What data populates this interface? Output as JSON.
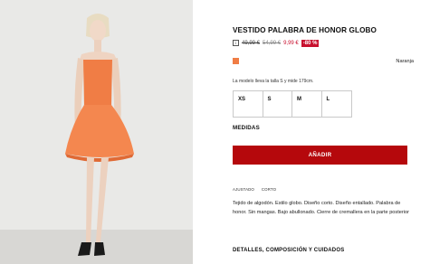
{
  "product": {
    "title": "VESTIDO PALABRA DE HONOR GLOBO",
    "price_icon": "i",
    "old_price_1": "49,99 €",
    "old_price_2": "54,99 €",
    "sale_price": "9,99 €",
    "discount_badge": "-80 %",
    "color_swatch": "#f07d45",
    "color_name": "Naranja",
    "model_note": "La modelo lleva la talla S y mide 179cm.",
    "sizes": [
      "XS",
      "S",
      "M",
      "L"
    ],
    "measures_label": "MEDIDAS",
    "add_button_label": "AÑADIR",
    "fit_tags": [
      "AJUSTADO",
      "CORTO"
    ],
    "description": "Tejido de algodón. Estilo globo. Diseño corto. Diseño entallado. Palabra de honor. Sin mangas. Bajo abullonado. Cierre de cremallera en la parte posterior",
    "details_label": "DETALLES, COMPOSICIÓN Y CUIDADOS"
  },
  "colors": {
    "accent_red": "#c8102e",
    "button_red": "#b5080c",
    "dress_orange": "#f07d45"
  }
}
